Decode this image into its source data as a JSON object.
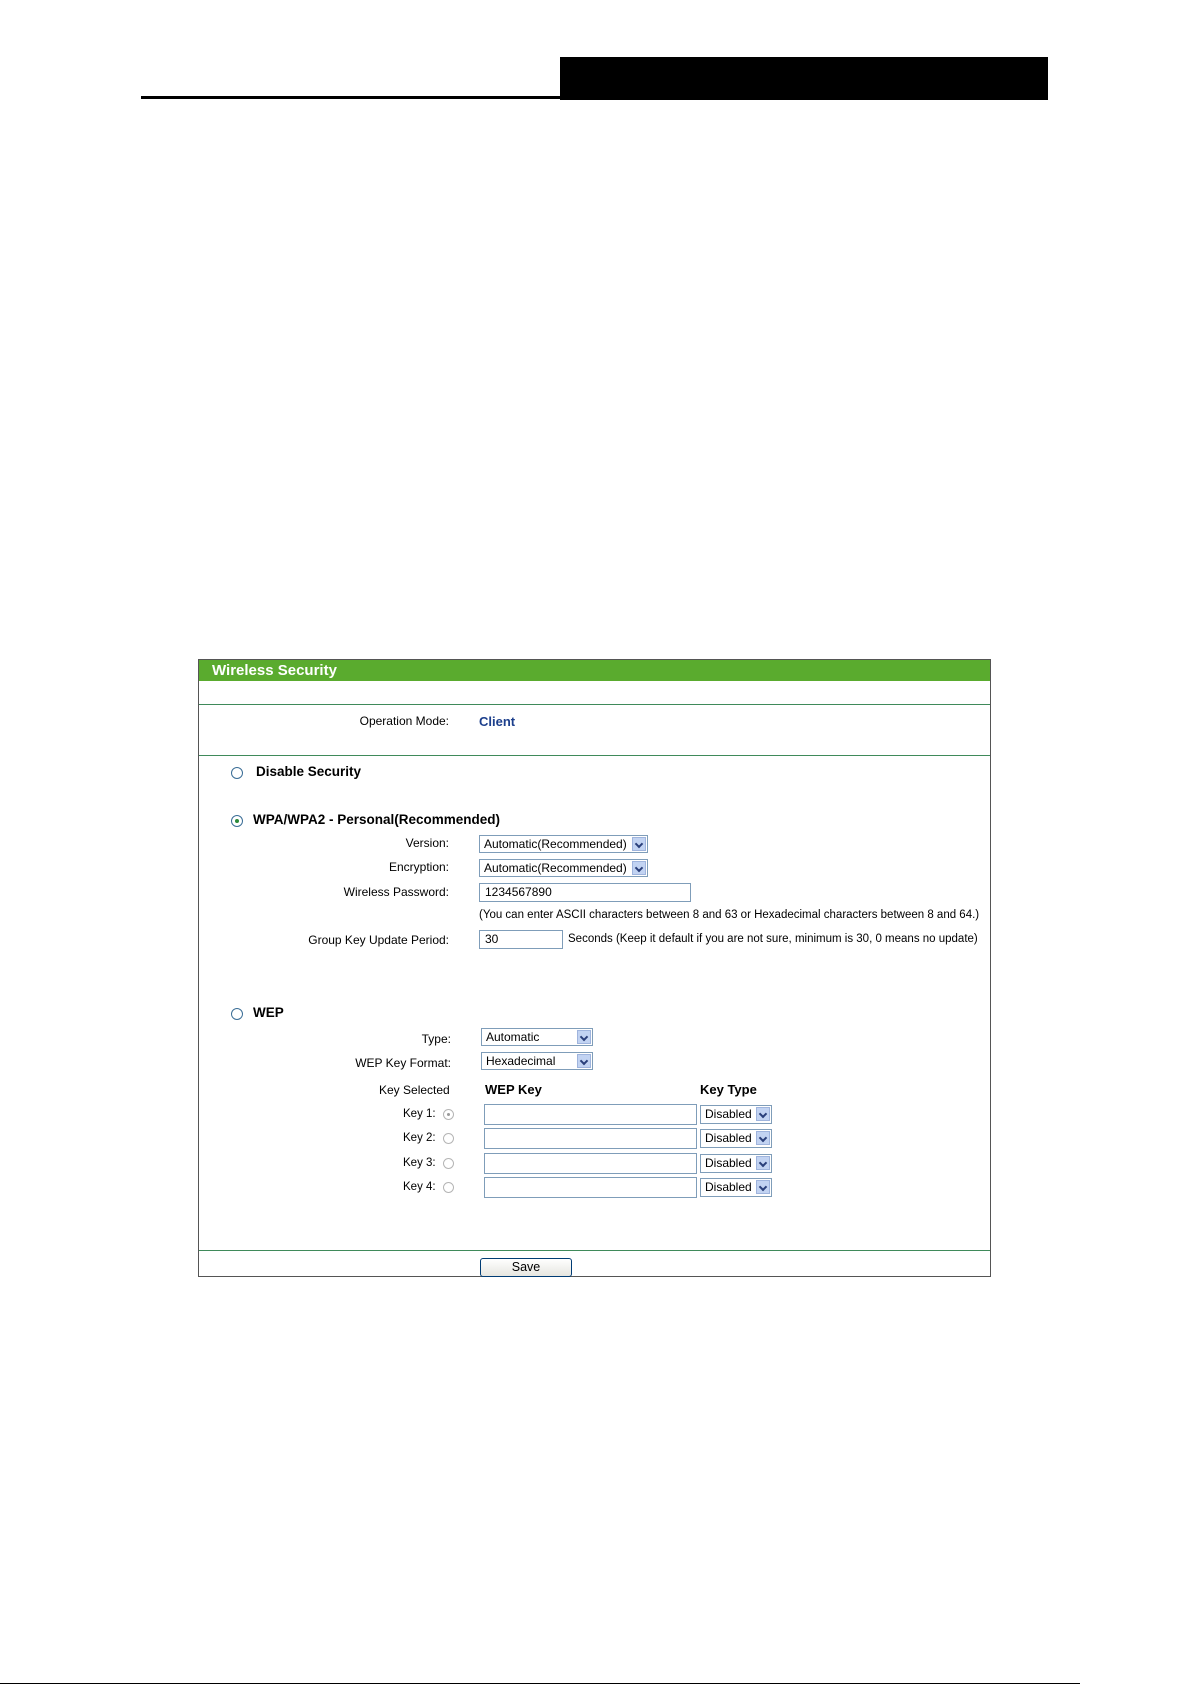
{
  "panel": {
    "title": "Wireless Security",
    "operation_mode_label": "Operation Mode:",
    "operation_mode_value": "Client",
    "disable_security_label": "Disable Security",
    "wpa": {
      "label": "WPA/WPA2 - Personal(Recommended)",
      "version_label": "Version:",
      "version_value": "Automatic(Recommended)",
      "encryption_label": "Encryption:",
      "encryption_value": "Automatic(Recommended)",
      "password_label": "Wireless Password:",
      "password_value": "1234567890",
      "password_note": "(You can enter ASCII characters between 8 and 63 or Hexadecimal characters between 8 and 64.)",
      "group_key_label": "Group Key Update Period:",
      "group_key_value": "30",
      "group_key_note": "Seconds (Keep it default if you are not sure, minimum is 30, 0 means no update)"
    },
    "wep": {
      "label": "WEP",
      "type_label": "Type:",
      "type_value": "Automatic",
      "format_label": "WEP Key Format:",
      "format_value": "Hexadecimal",
      "col_key_selected": "Key Selected",
      "col_wep_key": "WEP Key",
      "col_key_type": "Key Type",
      "keys": [
        {
          "label": "Key 1:",
          "value": "",
          "type": "Disabled"
        },
        {
          "label": "Key 2:",
          "value": "",
          "type": "Disabled"
        },
        {
          "label": "Key 3:",
          "value": "",
          "type": "Disabled"
        },
        {
          "label": "Key 4:",
          "value": "",
          "type": "Disabled"
        }
      ]
    },
    "save_label": "Save"
  }
}
